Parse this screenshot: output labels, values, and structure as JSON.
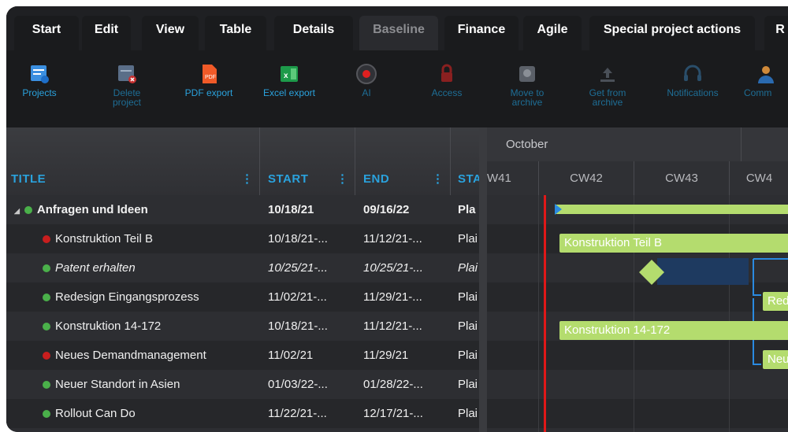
{
  "tabs": [
    {
      "label": "Start"
    },
    {
      "label": "Edit"
    },
    {
      "label": "View"
    },
    {
      "label": "Table"
    },
    {
      "label": "Details"
    },
    {
      "label": "Baseline"
    },
    {
      "label": "Finance"
    },
    {
      "label": "Agile"
    },
    {
      "label": "Special project actions"
    },
    {
      "label": "R"
    }
  ],
  "toolbar": [
    {
      "label": "Projects",
      "icon": "projects-icon"
    },
    {
      "label": "Delete\nproject",
      "icon": "delete-project-icon"
    },
    {
      "label": "PDF export",
      "icon": "pdf-icon"
    },
    {
      "label": "Excel export",
      "icon": "excel-icon"
    },
    {
      "label": "AI",
      "icon": "ai-icon"
    },
    {
      "label": "Access",
      "icon": "lock-icon"
    },
    {
      "label": "Move to\narchive",
      "icon": "archive-icon"
    },
    {
      "label": "Get from\narchive",
      "icon": "upload-icon"
    },
    {
      "label": "Notifications",
      "icon": "headset-icon"
    },
    {
      "label": "Comm",
      "icon": "person-icon"
    }
  ],
  "grid": {
    "columns": [
      {
        "label": "TITLE"
      },
      {
        "label": "START"
      },
      {
        "label": "END"
      },
      {
        "label": "STA"
      }
    ],
    "rows": [
      {
        "title": "Anfragen und Ideen",
        "start": "10/18/21",
        "end": "09/16/22",
        "status": "Pla",
        "dot": "#4ab04a",
        "bold": true,
        "italic": false,
        "expander": "◢"
      },
      {
        "title": "Konstruktion Teil B",
        "start": "10/18/21-...",
        "end": "11/12/21-...",
        "status": "Plai",
        "dot": "#c81e1e",
        "bold": false,
        "italic": false,
        "expander": ""
      },
      {
        "title": "Patent erhalten",
        "start": "10/25/21-...",
        "end": "10/25/21-...",
        "status": "Plai",
        "dot": "#4ab04a",
        "bold": false,
        "italic": true,
        "expander": ""
      },
      {
        "title": "Redesign Eingangsprozess",
        "start": "11/02/21-...",
        "end": "11/29/21-...",
        "status": "Plai",
        "dot": "#4ab04a",
        "bold": false,
        "italic": false,
        "expander": ""
      },
      {
        "title": "Konstruktion 14-172",
        "start": "10/18/21-...",
        "end": "11/12/21-...",
        "status": "Plai",
        "dot": "#4ab04a",
        "bold": false,
        "italic": false,
        "expander": ""
      },
      {
        "title": "Neues Demandmanagement",
        "start": "11/02/21",
        "end": "11/29/21",
        "status": "Plai",
        "dot": "#c81e1e",
        "bold": false,
        "italic": false,
        "expander": ""
      },
      {
        "title": "Neuer Standort in Asien",
        "start": "01/03/22-...",
        "end": "01/28/22-...",
        "status": "Plai",
        "dot": "#4ab04a",
        "bold": false,
        "italic": false,
        "expander": ""
      },
      {
        "title": "Rollout Can Do",
        "start": "11/22/21-...",
        "end": "12/17/21-...",
        "status": "Plai",
        "dot": "#4ab04a",
        "bold": false,
        "italic": false,
        "expander": ""
      }
    ]
  },
  "gantt": {
    "month": "October",
    "weeks": [
      "W41",
      "CW42",
      "CW43",
      "CW4"
    ],
    "bars": [
      {
        "label": "Konstruktion Teil B"
      },
      {
        "label": "Red"
      },
      {
        "label": "Konstruktion 14-172"
      },
      {
        "label": "Neu"
      }
    ]
  },
  "colors": {
    "accent": "#2aa2dd",
    "bar": "#b4dc6e",
    "today": "#e01818",
    "milestone": "#b4dc6e",
    "summary_fill": "#1e3a60"
  }
}
